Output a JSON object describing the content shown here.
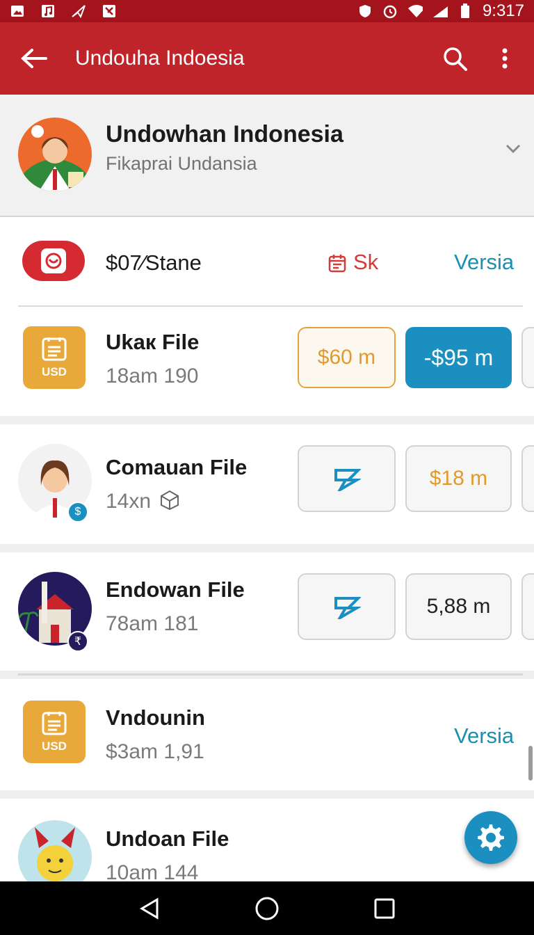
{
  "status_bar": {
    "time": "9:317"
  },
  "app_bar": {
    "title": "Undouha Indoesia"
  },
  "profile": {
    "name": "Undowhan Indonesia",
    "subtitle": "Fikaprai Undansia"
  },
  "rows": [
    {
      "title": "$07⁄Stane",
      "badge": "Sk",
      "link": "Versia"
    },
    {
      "title": "Ukaк File",
      "subtitle": "18am 190",
      "icon_label": "USD",
      "pills": [
        "$60 m",
        "-$95 m"
      ]
    },
    {
      "title": "Comauan File",
      "subtitle": "14xn",
      "pills": [
        "",
        "$18 m"
      ]
    },
    {
      "title": "Endowan File",
      "subtitle": "78am 181",
      "pills": [
        "",
        "5,88 m"
      ]
    },
    {
      "title": "Vndounin",
      "subtitle": "$3am 1,91",
      "icon_label": "USD",
      "link": "Versia"
    },
    {
      "title": "Undoan File",
      "subtitle": "10am 144"
    }
  ],
  "colors": {
    "brand_red": "#c0242b",
    "accent_blue": "#1a8fc0",
    "accent_orange": "#e9a83a"
  }
}
